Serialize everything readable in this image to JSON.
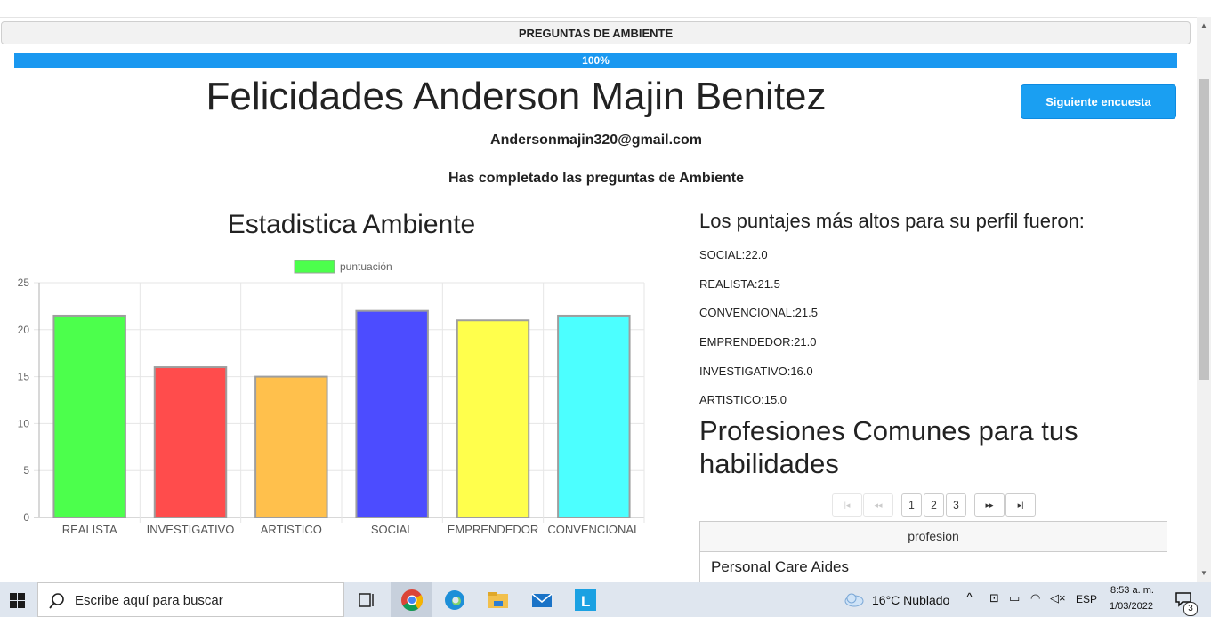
{
  "header": {
    "title": "PREGUNTAS DE AMBIENTE"
  },
  "progress": {
    "label": "100%",
    "value": 100
  },
  "main": {
    "title": "Felicidades Anderson Majin Benitez",
    "email": "Andersonmajin320@gmail.com",
    "completed_text": "Has completado las preguntas de Ambiente",
    "next_button": "Siguiente encuesta"
  },
  "chart_section": {
    "title": "Estadistica Ambiente"
  },
  "chart_data": {
    "type": "bar",
    "title": "Estadistica Ambiente",
    "categories": [
      "REALISTA",
      "INVESTIGATIVO",
      "ARTISTICO",
      "SOCIAL",
      "EMPRENDEDOR",
      "CONVENCIONAL"
    ],
    "series": [
      {
        "name": "puntuación",
        "values": [
          21.5,
          16,
          15,
          22,
          21,
          21.5
        ]
      }
    ],
    "colors": [
      "#4cff4c",
      "#ff4c4c",
      "#ffc04c",
      "#4c4cff",
      "#ffff4c",
      "#4cffff"
    ],
    "border_color": "#9e9e9e",
    "legend_color": "#4cff4c",
    "ylim": [
      0,
      25
    ],
    "yticks": [
      0,
      5,
      10,
      15,
      20,
      25
    ],
    "grid": true,
    "legend_position": "top"
  },
  "scores": {
    "title": "Los puntajes más altos para su perfil fueron:",
    "items": [
      "SOCIAL:22.0",
      "REALISTA:21.5",
      "CONVENCIONAL:21.5",
      "EMPRENDEDOR:21.0",
      "INVESTIGATIVO:16.0",
      "ARTISTICO:15.0"
    ]
  },
  "professions": {
    "title": "Profesiones Comunes para tus habilidades",
    "pager": {
      "first": "|◂",
      "prev": "◂◂",
      "pages": [
        "1",
        "2",
        "3"
      ],
      "next": "▸▸",
      "last": "▸|"
    },
    "column_header": "profesion",
    "rows": [
      "Personal Care Aides"
    ]
  },
  "taskbar": {
    "search_placeholder": "Escribe aquí para buscar",
    "weather": "16°C  Nublado",
    "language": "ESP",
    "time": "8:53 a. m.",
    "date": "1/03/2022",
    "notifications": "3"
  }
}
